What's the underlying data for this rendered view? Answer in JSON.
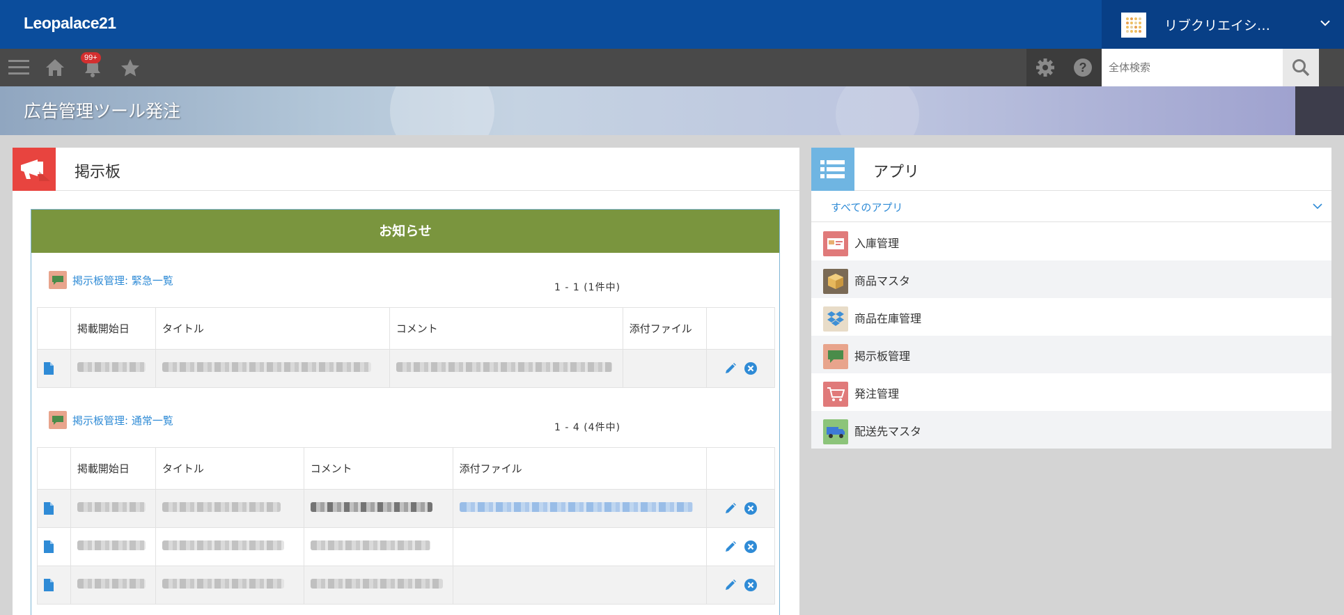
{
  "header": {
    "logo": "Leopalace21",
    "account_name": "リブクリエイシ…"
  },
  "toolbar": {
    "notification_badge": "99+",
    "search_placeholder": "全体検索"
  },
  "page": {
    "title": "広告管理ツール発注"
  },
  "bulletin": {
    "title": "掲示板",
    "notice_header": "お知らせ",
    "sections": [
      {
        "link_label": "掲示板管理: 緊急一覧",
        "pager": "1 - 1 (1件中)",
        "columns": [
          "掲載開始日",
          "タイトル",
          "コメント",
          "添付ファイル"
        ]
      },
      {
        "link_label": "掲示板管理: 通常一覧",
        "pager": "1 - 4 (4件中)",
        "columns": [
          "掲載開始日",
          "タイトル",
          "コメント",
          "添付ファイル"
        ]
      }
    ]
  },
  "apps": {
    "title": "アプリ",
    "filter_label": "すべてのアプリ",
    "items": [
      {
        "label": "入庫管理",
        "icon": "inventory-card-icon",
        "color": "#e07a7a"
      },
      {
        "label": "商品マスタ",
        "icon": "box-icon",
        "color": "#7a6a55"
      },
      {
        "label": "商品在庫管理",
        "icon": "dropbox-icon",
        "color": "#e8dcc8"
      },
      {
        "label": "掲示板管理",
        "icon": "speech-bubble-icon",
        "color": "#e8a48c"
      },
      {
        "label": "発注管理",
        "icon": "cart-icon",
        "color": "#e07a7a"
      },
      {
        "label": "配送先マスタ",
        "icon": "truck-icon",
        "color": "#8cc47a"
      }
    ]
  },
  "colors": {
    "header_blue": "#0b4d9c",
    "toolbar_gray": "#494949",
    "notice_green": "#7a953e",
    "link_blue": "#2f8bd6",
    "bulletin_red": "#e8443f",
    "apps_blue": "#6fb5e2"
  }
}
